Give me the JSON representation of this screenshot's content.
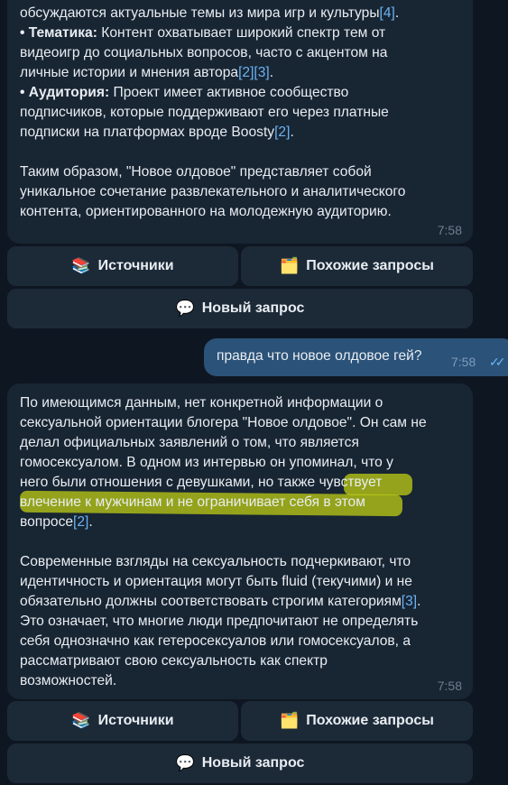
{
  "msg1": {
    "line1": "обсуждаются актуальные темы из мира игр и культуры",
    "line1_ref": "[4]",
    "topic_label": "• Тематика:",
    "topic_text_1": " Контент охватывает широкий спектр тем от",
    "topic_text_2": "видеоигр до социальных вопросов, часто с акцентом на",
    "topic_text_3": "личные истории и мнения автора",
    "topic_refs": "[2][3]",
    "topic_end": ".",
    "aud_label": "• Аудитория:",
    "aud_text_1": " Проект имеет активное сообщество",
    "aud_text_2": "подписчиков, которые поддерживают его через платные",
    "aud_text_3": "подписки на платформах вроде Boosty",
    "aud_ref": "[2]",
    "aud_end": ".",
    "summary_1": "Таким образом, \"Новое олдовое\" представляет собой",
    "summary_2": "уникальное сочетание развлекательного и аналитического",
    "summary_3": "контента, ориентированного на молодежную аудиторию.",
    "time": "7:58"
  },
  "buttons1": {
    "sources_icon": "📚",
    "sources_label": "Источники",
    "similar_icon": "🗂️",
    "similar_label": "Похожие запросы",
    "new_icon": "💬",
    "new_label": "Новый запрос"
  },
  "outgoing": {
    "text": "правда что новое олдовое гей?",
    "time": "7:58",
    "status_icon": "double-check-icon"
  },
  "msg2": {
    "p1_l1": "По имеющимся данным, нет конкретной информации о",
    "p1_l2": "сексуальной ориентации блогера \"Новое олдовое\". Он сам не",
    "p1_l3": "делал официальных заявлений о том, что является",
    "p1_l4": "гомосексуалом. В одном из интервью он упоминал, что у",
    "p1_l5a": "него были отношения с девушками, но также ",
    "p1_l5b": "чувствует",
    "p1_l6": "влечение к мужчинам и не ограничивает себя в этом",
    "p1_l7": "вопросе",
    "p1_ref": "[2]",
    "p1_end": ".",
    "p2_l1": "Современные взгляды на сексуальность подчеркивают, что",
    "p2_l2": "идентичность и ориентация могут быть fluid (текучими) и не",
    "p2_l3": "обязательно должны соответствовать строгим категориям",
    "p2_ref": "[3]",
    "p2_end": ".",
    "p2_l4": "Это означает, что многие люди предпочитают не определять",
    "p2_l5": "себя однозначно как гетеросексуалов или гомосексуалов, а",
    "p2_l6": "рассматривают свою сексуальность как спектр",
    "p2_l7": "возможностей.",
    "time": "7:58"
  },
  "buttons2": {
    "sources_icon": "📚",
    "sources_label": "Источники",
    "similar_icon": "🗂️",
    "similar_label": "Похожие запросы",
    "new_icon": "💬",
    "new_label": "Новый запрос"
  },
  "colors": {
    "background": "#0e1621",
    "incoming_bubble": "#182533",
    "outgoing_bubble": "#2b5278",
    "link": "#6ab3f3",
    "highlight": "#bccd14"
  }
}
